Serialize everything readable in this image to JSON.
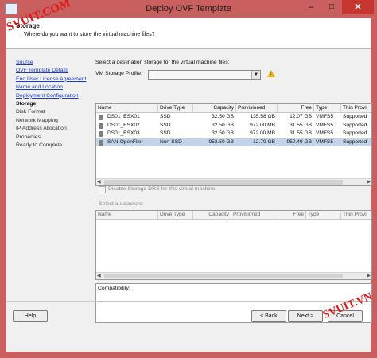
{
  "window": {
    "title": "Deploy OVF Template",
    "minimize": "–",
    "maximize": "□",
    "close": "✕"
  },
  "watermark": {
    "top": "SVUIT.COM",
    "bottom": "SVUIT.VN"
  },
  "header": {
    "title": "Storage",
    "subtitle": "Where do you want to store the virtual machine files?"
  },
  "nav": {
    "items": [
      {
        "label": "Source",
        "state": "link"
      },
      {
        "label": "OVF Template Details",
        "state": "link"
      },
      {
        "label": "End User License Agreement",
        "state": "link"
      },
      {
        "label": "Name and Location",
        "state": "link"
      },
      {
        "label": "Deployment Configuration",
        "state": "link"
      },
      {
        "label": "Storage",
        "state": "current"
      },
      {
        "label": "Disk Format",
        "state": "pending"
      },
      {
        "label": "Network Mapping",
        "state": "pending"
      },
      {
        "label": "IP Address Allocation",
        "state": "pending"
      },
      {
        "label": "Properties",
        "state": "pending"
      },
      {
        "label": "Ready to Complete",
        "state": "pending"
      }
    ]
  },
  "main": {
    "instruction": "Select a destination storage for the virtual machine files:",
    "profile_label": "VM Storage Profile:",
    "profile_value": "",
    "columns": [
      "Name",
      "Drive Type",
      "Capacity",
      "Provisioned",
      "Free",
      "Type",
      "Thin Provi"
    ],
    "rows": [
      {
        "name": "DS01_ESX01",
        "drive": "SSD",
        "capacity": "32.50 GB",
        "provisioned": "135.58 GB",
        "free": "12.07 GB",
        "type": "VMFS5",
        "thin": "Supported",
        "selected": false
      },
      {
        "name": "DS01_ESX02",
        "drive": "SSD",
        "capacity": "32.50 GB",
        "provisioned": "972.00 MB",
        "free": "31.55 GB",
        "type": "VMFS5",
        "thin": "Supported",
        "selected": false
      },
      {
        "name": "DS01_ESX03",
        "drive": "SSD",
        "capacity": "32.50 GB",
        "provisioned": "972.00 MB",
        "free": "31.55 GB",
        "type": "VMFS5",
        "thin": "Supported",
        "selected": false
      },
      {
        "name": "SAN-OpenFiler",
        "drive": "Non-SSD",
        "capacity": "953.50 GB",
        "provisioned": "12.79 GB",
        "free": "950.49 GB",
        "type": "VMFS5",
        "thin": "Supported",
        "selected": true
      }
    ],
    "disable_sdrs_label": "Disable Storage DRS for this virtual machine",
    "datastore_label": "Select a datastore:",
    "columns2": [
      "Name",
      "Drive Type",
      "Capacity",
      "Provisioned",
      "Free",
      "Type",
      "Thin Provi"
    ],
    "compat_label": "Compatibility:"
  },
  "footer": {
    "help": "Help",
    "back": "≤ Back",
    "next": "Next >",
    "cancel": "Cancel"
  }
}
